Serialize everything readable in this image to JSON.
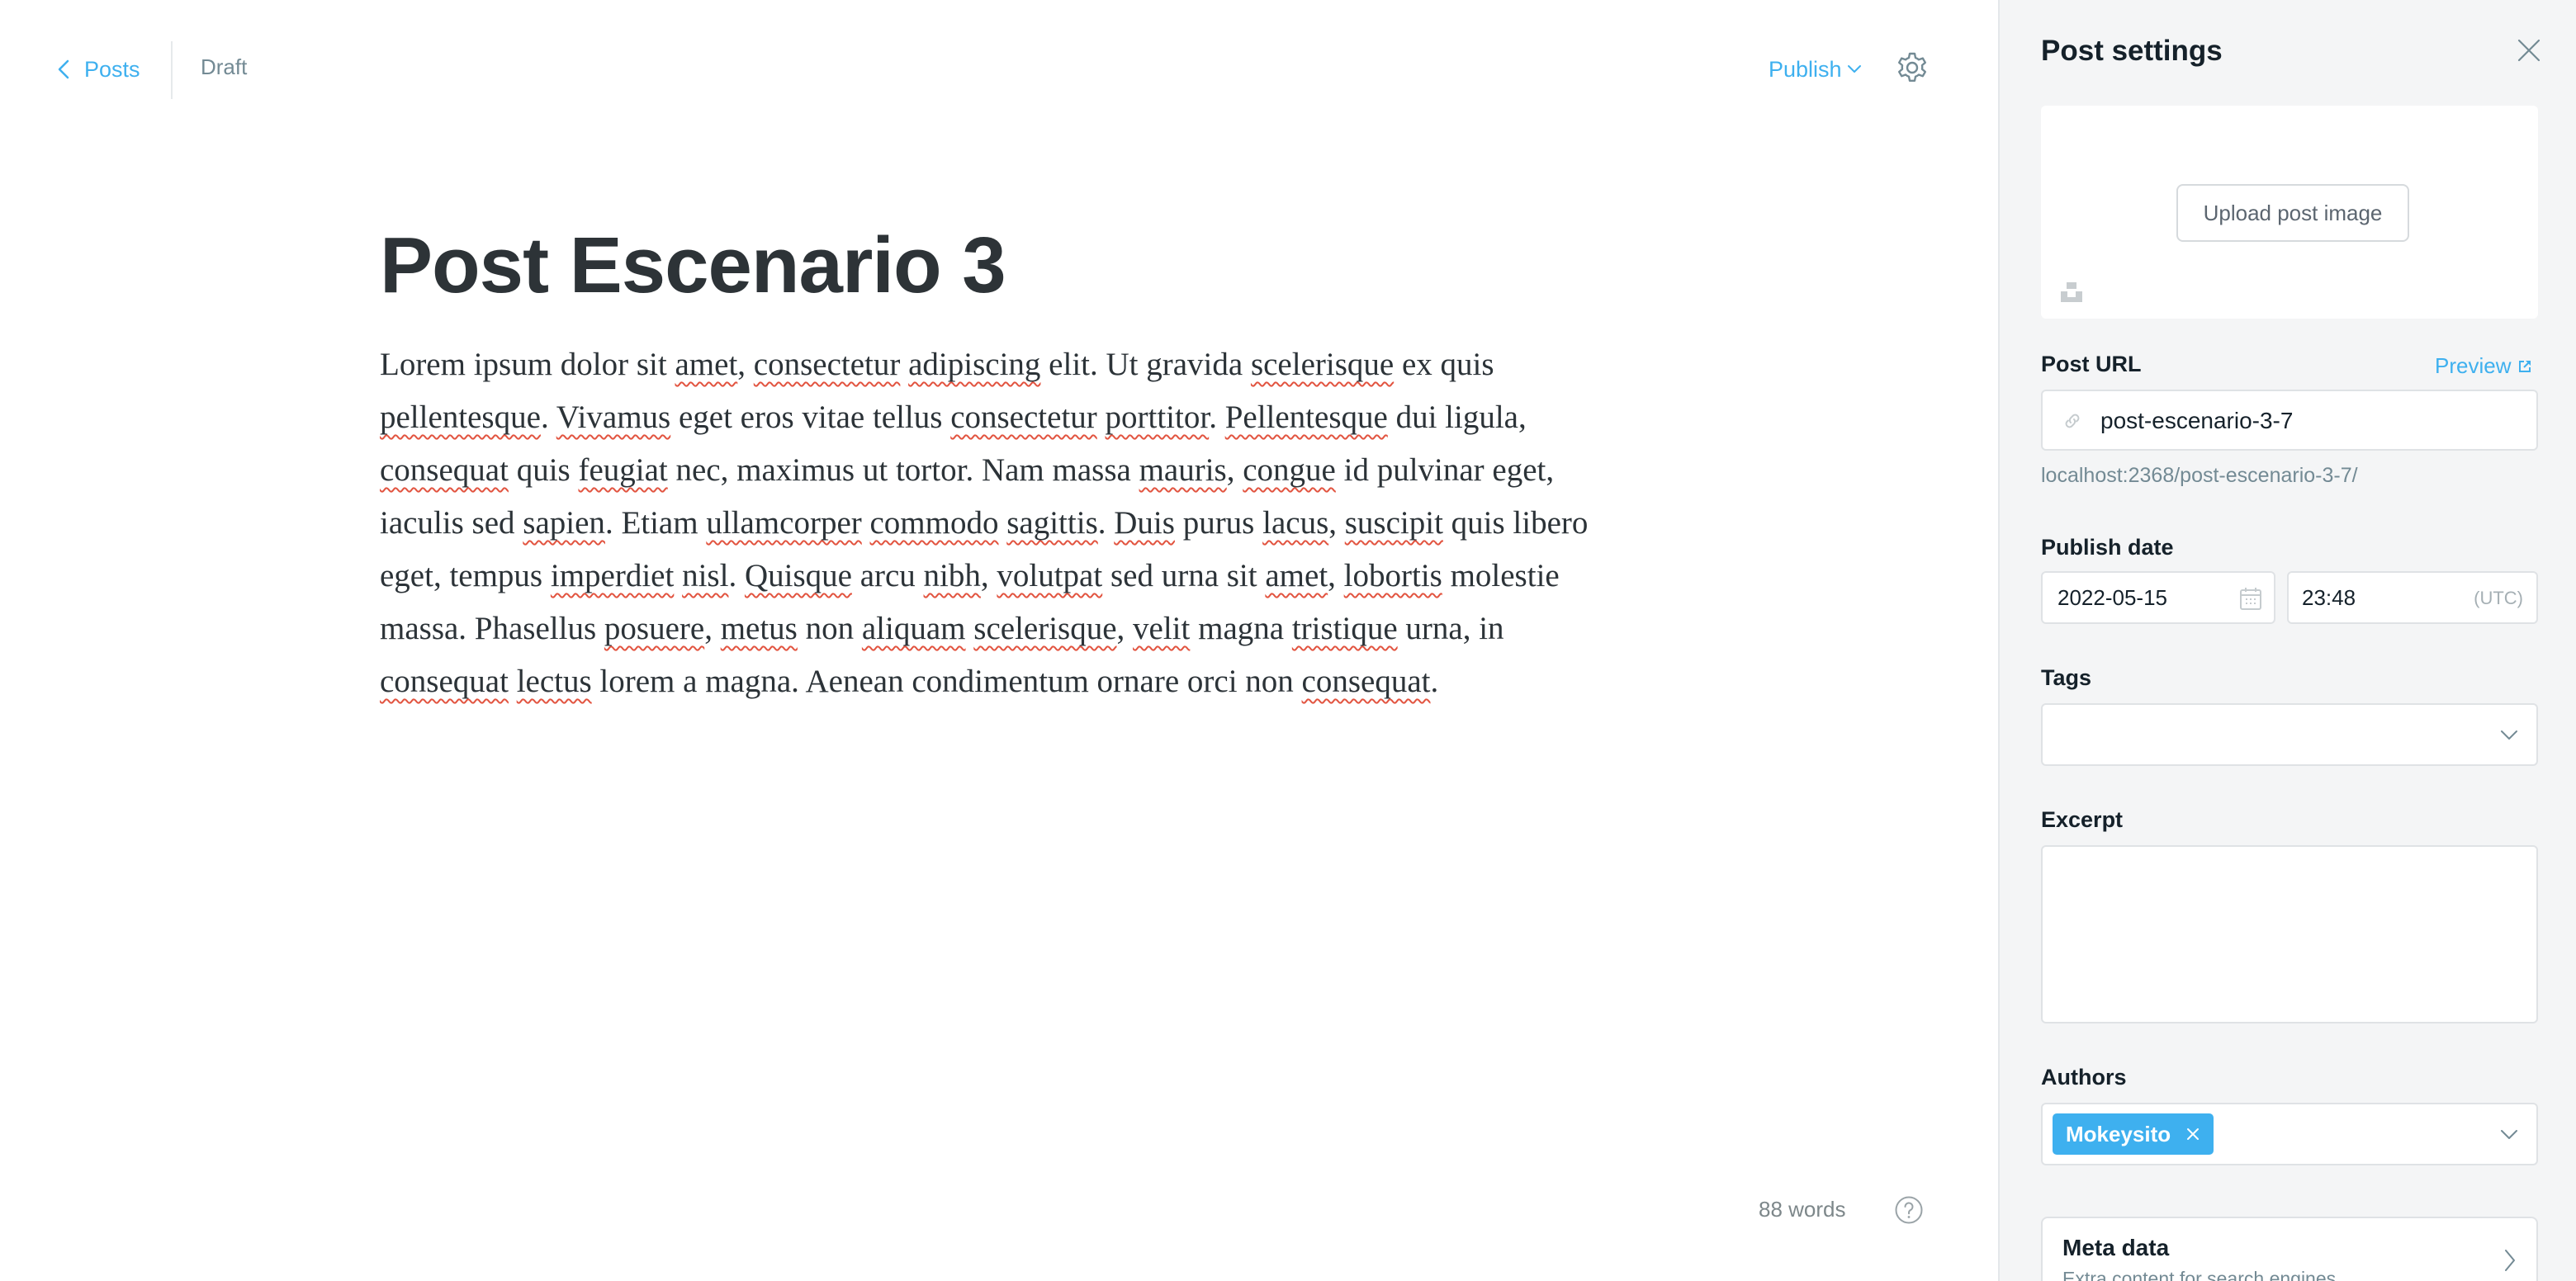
{
  "topbar": {
    "back_label": "Posts",
    "status": "Draft",
    "publish_label": "Publish"
  },
  "post": {
    "title": "Post Escenario 3",
    "body_segments": [
      {
        "t": "Lorem ipsum dolor sit "
      },
      {
        "t": "amet",
        "sp": true
      },
      {
        "t": ", "
      },
      {
        "t": "consectetur",
        "sp": true
      },
      {
        "t": " "
      },
      {
        "t": "adipiscing",
        "sp": true
      },
      {
        "t": " elit. Ut gravida "
      },
      {
        "t": "scelerisque",
        "sp": true
      },
      {
        "t": " ex quis "
      },
      {
        "t": "pellentesque",
        "sp": true
      },
      {
        "t": ". "
      },
      {
        "t": "Vivamus",
        "sp": true
      },
      {
        "t": " eget eros vitae tellus "
      },
      {
        "t": "consectetur",
        "sp": true
      },
      {
        "t": " "
      },
      {
        "t": "porttitor",
        "sp": true
      },
      {
        "t": ". "
      },
      {
        "t": "Pellentesque",
        "sp": true
      },
      {
        "t": " dui ligula, "
      },
      {
        "t": "consequat",
        "sp": true
      },
      {
        "t": " quis "
      },
      {
        "t": "feugiat",
        "sp": true
      },
      {
        "t": " nec, maximus ut tortor. Nam massa "
      },
      {
        "t": "mauris",
        "sp": true
      },
      {
        "t": ", "
      },
      {
        "t": "congue",
        "sp": true
      },
      {
        "t": " id pulvinar eget, iaculis sed "
      },
      {
        "t": "sapien",
        "sp": true
      },
      {
        "t": ". Etiam "
      },
      {
        "t": "ullamcorper",
        "sp": true
      },
      {
        "t": " "
      },
      {
        "t": "commodo",
        "sp": true
      },
      {
        "t": " "
      },
      {
        "t": "sagittis",
        "sp": true
      },
      {
        "t": ". "
      },
      {
        "t": "Duis",
        "sp": true
      },
      {
        "t": " purus "
      },
      {
        "t": "lacus",
        "sp": true
      },
      {
        "t": ", "
      },
      {
        "t": "suscipit",
        "sp": true
      },
      {
        "t": " quis libero eget, tempus "
      },
      {
        "t": "imperdiet",
        "sp": true
      },
      {
        "t": " "
      },
      {
        "t": "nisl",
        "sp": true
      },
      {
        "t": ". "
      },
      {
        "t": "Quisque",
        "sp": true
      },
      {
        "t": " arcu "
      },
      {
        "t": "nibh",
        "sp": true
      },
      {
        "t": ", "
      },
      {
        "t": "volutpat",
        "sp": true
      },
      {
        "t": " sed urna sit "
      },
      {
        "t": "amet",
        "sp": true
      },
      {
        "t": ", "
      },
      {
        "t": "lobortis",
        "sp": true
      },
      {
        "t": " molestie massa. Phasellus "
      },
      {
        "t": "posuere",
        "sp": true
      },
      {
        "t": ", "
      },
      {
        "t": "metus",
        "sp": true
      },
      {
        "t": " non "
      },
      {
        "t": "aliquam",
        "sp": true
      },
      {
        "t": " "
      },
      {
        "t": "scelerisque",
        "sp": true
      },
      {
        "t": ", "
      },
      {
        "t": "velit",
        "sp": true
      },
      {
        "t": " magna "
      },
      {
        "t": "tristique",
        "sp": true
      },
      {
        "t": " urna, in "
      },
      {
        "t": "consequat",
        "sp": true
      },
      {
        "t": " "
      },
      {
        "t": "lectus",
        "sp": true
      },
      {
        "t": " lorem a magna. Aenean condimentum ornare orci non "
      },
      {
        "t": "consequat",
        "sp": true
      },
      {
        "t": "."
      }
    ],
    "word_count": "88 words"
  },
  "settings": {
    "title": "Post settings",
    "upload_label": "Upload post image",
    "url_label": "Post URL",
    "preview_label": "Preview",
    "url_value": "post-escenario-3-7",
    "url_hint": "localhost:2368/post-escenario-3-7/",
    "publish_date_label": "Publish date",
    "date_value": "2022-05-15",
    "time_value": "23:48",
    "timezone": "(UTC)",
    "tags_label": "Tags",
    "excerpt_label": "Excerpt",
    "excerpt_value": "",
    "authors_label": "Authors",
    "author": "Mokeysito",
    "meta_title": "Meta data",
    "meta_subtitle": "Extra content for search engines"
  },
  "icons": {
    "back": "chevron-left-icon",
    "publish_dropdown": "chevron-down-icon",
    "settings": "gear-icon",
    "help": "question-circle-icon",
    "close": "close-icon",
    "unsplash": "unsplash-icon",
    "preview": "external-link-icon",
    "url": "link-icon",
    "date": "calendar-icon",
    "meta": "chevron-right-icon"
  },
  "colors": {
    "accent": "#3eb0ef",
    "spellcheck": "#e25440",
    "panel_bg": "#f4f5f6"
  }
}
